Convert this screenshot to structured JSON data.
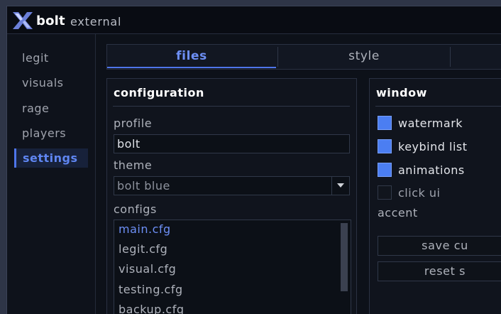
{
  "app": {
    "name": "bolt",
    "subtitle": "external"
  },
  "sidebar": {
    "items": [
      {
        "label": "legit"
      },
      {
        "label": "visuals"
      },
      {
        "label": "rage"
      },
      {
        "label": "players"
      },
      {
        "label": "settings",
        "active": true
      }
    ]
  },
  "tabs": [
    {
      "label": "files",
      "active": true
    },
    {
      "label": "style"
    },
    {
      "label": ""
    }
  ],
  "configuration": {
    "title": "configuration",
    "profile_label": "profile",
    "profile_value": "bolt",
    "theme_label": "theme",
    "theme_value": "bolt blue",
    "configs_label": "configs",
    "configs": [
      "main.cfg",
      "legit.cfg",
      "visual.cfg",
      "testing.cfg",
      "backup.cfg"
    ],
    "selected_config": "main.cfg"
  },
  "window": {
    "title": "window",
    "checkboxes": [
      {
        "label": "watermark",
        "checked": true
      },
      {
        "label": "keybind list",
        "checked": true
      },
      {
        "label": "animations",
        "checked": true
      },
      {
        "label": "click ui",
        "checked": false
      }
    ],
    "accent_label": "accent",
    "buttons": [
      {
        "label": "save cu"
      },
      {
        "label": "reset s"
      }
    ]
  },
  "colors": {
    "accent": "#4e75ea",
    "accent_text": "#6d8ff5",
    "checkbox_on": "#4b7ef2",
    "background": "#0d1119"
  }
}
